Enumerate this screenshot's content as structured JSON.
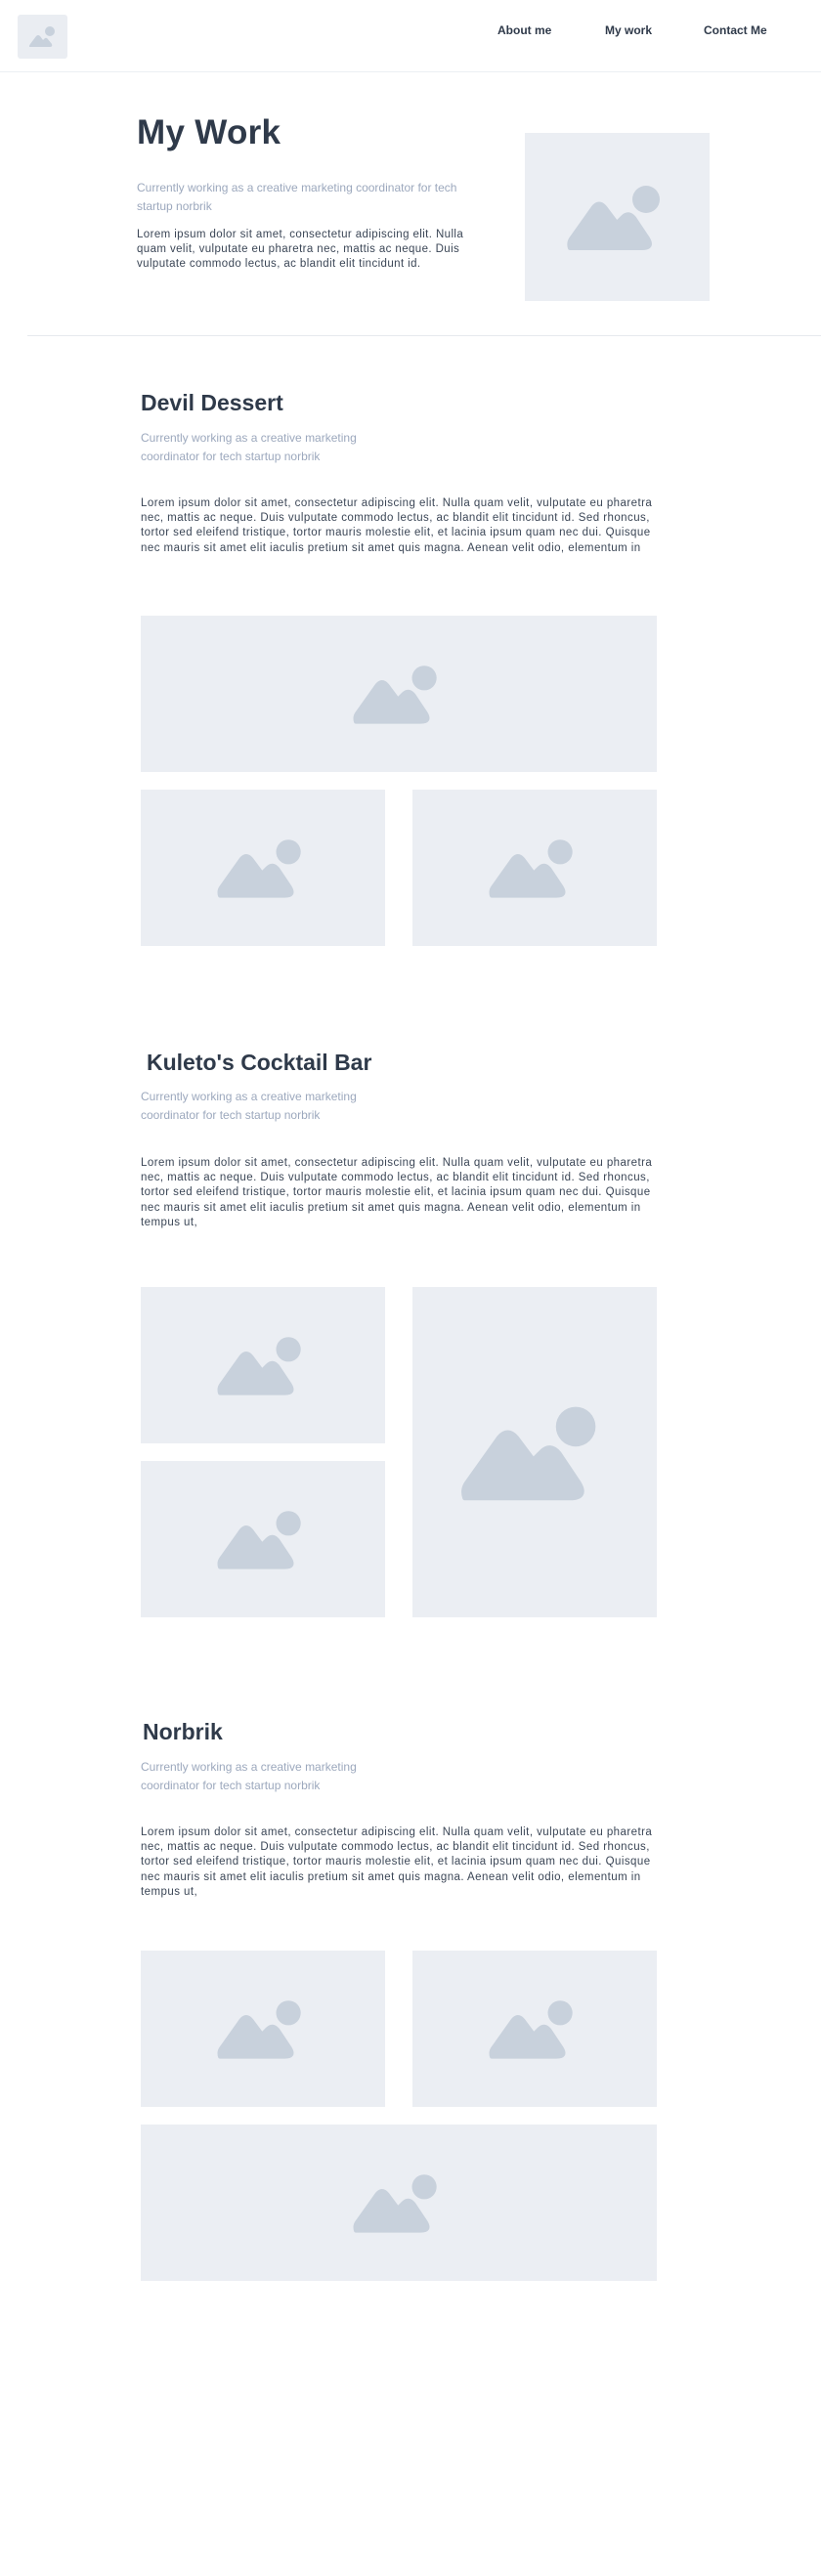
{
  "nav": {
    "logo_icon": "image-placeholder-icon",
    "links": [
      "About me",
      "My work",
      "Contact Me"
    ]
  },
  "hero": {
    "title": "My Work",
    "subtitle": "Currently working as a creative marketing coordinator for tech startup norbrik",
    "body": "Lorem ipsum dolor sit amet, consectetur adipiscing elit. Nulla quam velit, vulputate eu pharetra nec, mattis ac neque. Duis vulputate commodo lectus, ac blandit elit tincidunt id."
  },
  "projects": [
    {
      "title": "Devil Dessert",
      "subtitle": "Currently working as a creative marketing coordinator for tech startup norbrik",
      "body": "Lorem ipsum dolor sit amet, consectetur adipiscing elit. Nulla quam velit, vulputate eu pharetra nec, mattis ac neque. Duis vulputate commodo lectus, ac blandit elit tincidunt id. Sed rhoncus, tortor sed eleifend tristique, tortor mauris molestie elit, et lacinia ipsum quam nec dui. Quisque nec mauris sit amet elit iaculis pretium sit amet quis magna. Aenean velit odio, elementum in"
    },
    {
      "title": "Kuleto's Cocktail Bar",
      "subtitle": "Currently working as a creative marketing coordinator for tech startup norbrik",
      "body": "Lorem ipsum dolor sit amet, consectetur adipiscing elit. Nulla quam velit, vulputate eu pharetra nec, mattis ac neque. Duis vulputate commodo lectus, ac blandit elit tincidunt id. Sed rhoncus, tortor sed eleifend tristique, tortor mauris molestie elit, et lacinia ipsum quam nec dui. Quisque nec mauris sit amet elit iaculis pretium sit amet quis magna. Aenean velit odio, elementum in tempus ut,"
    },
    {
      "title": "Norbrik",
      "subtitle": "Currently working as a creative marketing coordinator for tech startup norbrik",
      "body": "Lorem ipsum dolor sit amet, consectetur adipiscing elit. Nulla quam velit, vulputate eu pharetra nec, mattis ac neque. Duis vulputate commodo lectus, ac blandit elit tincidunt id. Sed rhoncus, tortor sed eleifend tristique, tortor mauris molestie elit, et lacinia ipsum quam nec dui. Quisque nec mauris sit amet elit iaculis pretium sit amet quis magna. Aenean velit odio, elementum in tempus ut,"
    }
  ],
  "colors": {
    "placeholder_bg": "#ebeef3",
    "placeholder_icon": "#c8d1dc",
    "heading": "#2f3a4a",
    "subtitle": "#9ca8bd",
    "body": "#3b4656"
  },
  "image_icon": "image-placeholder-icon"
}
